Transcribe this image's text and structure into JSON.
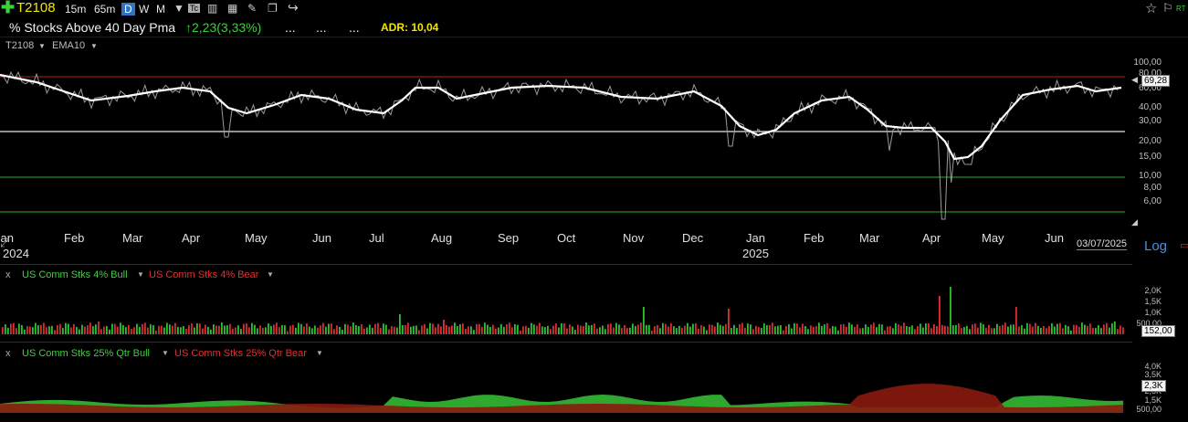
{
  "toolbar": {
    "symbol": "T2108",
    "timeframes": [
      "15m",
      "65m",
      "D",
      "W",
      "M"
    ],
    "active_timeframe": "D",
    "icons": [
      "add-symbol-icon",
      "dropdown-icon",
      "indicator-icon",
      "bar-style-icon",
      "calculator-icon",
      "draw-icon",
      "bookmark-icon",
      "share-icon",
      "star-icon",
      "flag-icon"
    ],
    "rt_label": "RT"
  },
  "header": {
    "title": "% Stocks Above 40 Day Pma",
    "change": "2,23(3,33%)",
    "dots": [
      "...",
      "...",
      "..."
    ],
    "adr": "ADR: 10,04"
  },
  "main_pane": {
    "series_label": "T2108",
    "overlay_label": "EMA10",
    "last_value": "69,28",
    "y_ticks": [
      "100,00",
      "80,00",
      "60,00",
      "40,00",
      "30,00",
      "20,00",
      "15,00",
      "10,00",
      "8,00",
      "6,00"
    ],
    "x_months": [
      "Jan",
      "Feb",
      "Mar",
      "Apr",
      "May",
      "Jun",
      "Jul",
      "Aug",
      "Sep",
      "Oct",
      "Nov",
      "Dec",
      "Jan",
      "Feb",
      "Mar",
      "Apr",
      "May",
      "Jun"
    ],
    "x_years": [
      "2024",
      "2025"
    ],
    "date": "03/07/2025",
    "log_label": "Log",
    "colors": {
      "price": "#9a9a9a",
      "ema": "#ffffff",
      "line_red": "#b02020",
      "line_white": "#e8e8e8",
      "line_green": "#28b428"
    }
  },
  "pane2": {
    "close": "x",
    "bull_label": "US Comm Stks 4% Bull",
    "bear_label": "US Comm Stks 4% Bear",
    "y_ticks": [
      "2,0K",
      "1,5K",
      "1,0K",
      "500,00"
    ],
    "last_value": "152,00"
  },
  "pane3": {
    "close": "x",
    "bull_label": "US Comm Stks 25% Qtr Bull",
    "bear_label": "US Comm Stks 25% Qtr Bear",
    "y_ticks": [
      "4,0K",
      "3,5K",
      "2,5K",
      "1,5K",
      "500,00"
    ],
    "last_value": "2,3K"
  }
}
